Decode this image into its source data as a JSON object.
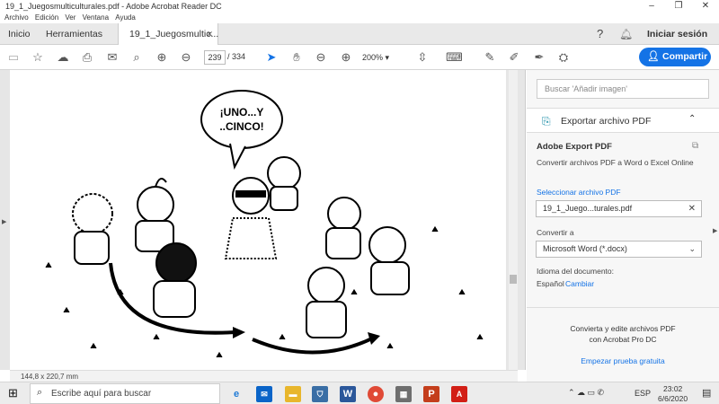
{
  "window": {
    "title": "19_1_Juegosmulticulturales.pdf - Adobe Acrobat Reader DC"
  },
  "menu": [
    "Archivo",
    "Edición",
    "Ver",
    "Ventana",
    "Ayuda"
  ],
  "tabs": {
    "home": "Inicio",
    "tools": "Herramientas",
    "doc": "19_1_Juegosmultic..."
  },
  "header": {
    "signin": "Iniciar sesión"
  },
  "toolbar": {
    "page_current": "239",
    "page_total": "/ 334",
    "zoom": "200%",
    "share": "Compartir"
  },
  "document": {
    "speech": [
      "¡UNO...Y",
      "..CINCO!"
    ],
    "dimensions": "144,8 x 220,7 mm"
  },
  "right_pane": {
    "search_placeholder": "Buscar 'Añadir imagen'",
    "export_title": "Exportar archivo PDF",
    "adobe_export": "Adobe Export PDF",
    "convert_desc": "Convertir archivos PDF a Word o Excel Online",
    "select_file": "Seleccionar archivo PDF",
    "file_name": "19_1_Juego...turales.pdf",
    "convert_to": "Convertir a",
    "format": "Microsoft Word (*.docx)",
    "doc_lang_label": "Idioma del documento:",
    "doc_lang": "Español",
    "change": "Cambiar",
    "promo_line1": "Convierta y edite archivos PDF",
    "promo_line2": "con Acrobat Pro DC",
    "trial": "Empezar prueba gratuita"
  },
  "taskbar": {
    "search_placeholder": "Escribe aquí para buscar",
    "lang": "ESP",
    "time": "23:02",
    "date": "6/6/2020"
  },
  "colors": {
    "accent": "#1473e6",
    "link": "#1473e6"
  }
}
